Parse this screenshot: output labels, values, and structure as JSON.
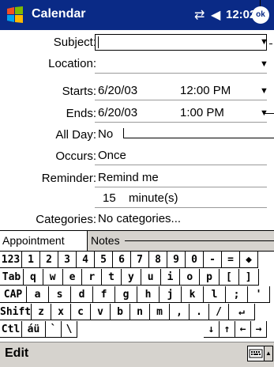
{
  "titlebar": {
    "app_title": "Calendar",
    "time": "12:02",
    "ok_label": "ok",
    "connectivity_glyph": "⇄",
    "volume_glyph": "◀"
  },
  "form": {
    "subject_label": "Subject:",
    "location_label": "Location:",
    "starts_label": "Starts:",
    "starts_date": "6/20/03",
    "starts_time": "12:00 PM",
    "ends_label": "Ends:",
    "ends_date": "6/20/03",
    "ends_time": "1:00 PM",
    "allday_label": "All Day:",
    "allday_value": "No",
    "occurs_label": "Occurs:",
    "occurs_value": "Once",
    "reminder_label": "Reminder:",
    "reminder_value": "Remind me",
    "reminder_amount": "15",
    "reminder_unit": "minute(s)",
    "categories_label": "Categories:",
    "categories_value": "No categories..."
  },
  "tabs": [
    {
      "label": "Appointment"
    },
    {
      "label": "Notes"
    }
  ],
  "keyboard": {
    "row1": [
      "123",
      "1",
      "2",
      "3",
      "4",
      "5",
      "6",
      "7",
      "8",
      "9",
      "0",
      "-",
      "=",
      "◆"
    ],
    "row2": [
      "Tab",
      "q",
      "w",
      "e",
      "r",
      "t",
      "y",
      "u",
      "i",
      "o",
      "p",
      "[",
      "]"
    ],
    "row3": [
      "CAP",
      "a",
      "s",
      "d",
      "f",
      "g",
      "h",
      "j",
      "k",
      "l",
      ";",
      "'"
    ],
    "row4": [
      "Shift",
      "z",
      "x",
      "c",
      "v",
      "b",
      "n",
      "m",
      ",",
      ".",
      "/",
      "↵"
    ],
    "row5": [
      "Ctl",
      "áü",
      "`",
      "\\",
      "↓",
      "↑",
      "←",
      "→"
    ]
  },
  "menubar": {
    "edit_label": "Edit"
  },
  "colors": {
    "titlebar": "#0a2a86",
    "bar": "#d6d3ce"
  }
}
